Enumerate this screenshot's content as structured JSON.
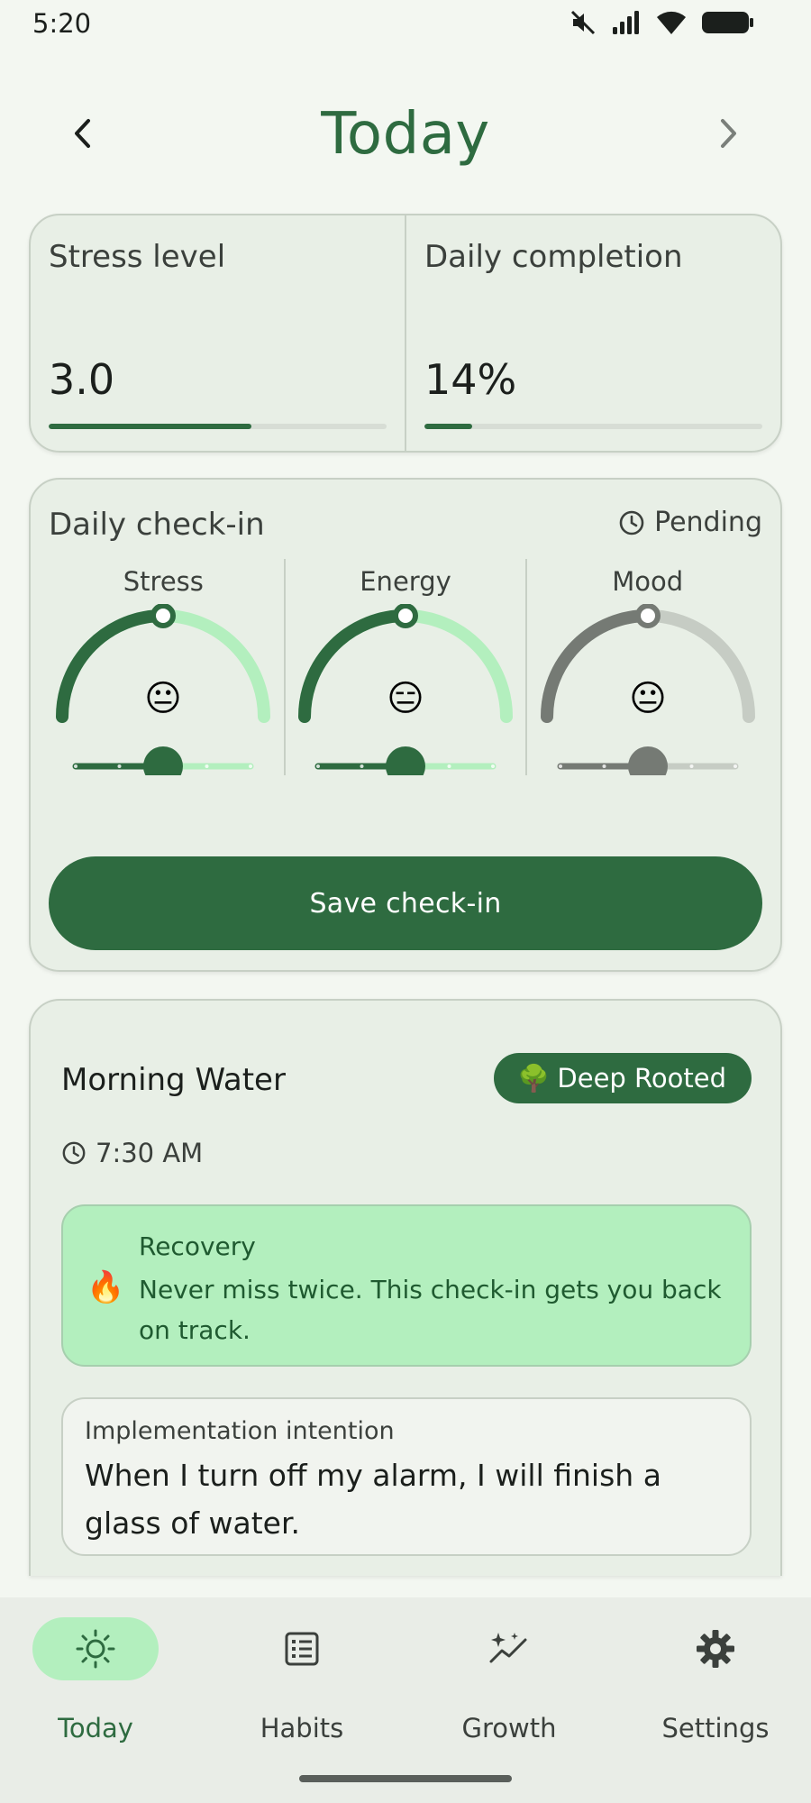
{
  "status_bar": {
    "time": "5:20",
    "icons": [
      "mute-icon",
      "signal-icon",
      "wifi-icon",
      "battery-icon"
    ]
  },
  "header": {
    "title": "Today",
    "prev_icon": "chevron-left-icon",
    "next_icon": "chevron-right-icon"
  },
  "stats": {
    "stress": {
      "label": "Stress level",
      "value": "3.0",
      "progress": 0.6
    },
    "completion": {
      "label": "Daily completion",
      "value": "14%",
      "progress": 0.14
    }
  },
  "checkin": {
    "title": "Daily check-in",
    "status": "Pending",
    "status_icon": "clock-icon",
    "dials": [
      {
        "label": "Stress",
        "emoji": "😐",
        "level": 0.5,
        "color": "#2e6b40",
        "track": "#b3efbe"
      },
      {
        "label": "Energy",
        "emoji": "😑",
        "level": 0.5,
        "color": "#2e6b40",
        "track": "#b3efbe"
      },
      {
        "label": "Mood",
        "emoji": "😐",
        "level": 0.5,
        "color": "#757a74",
        "track": "#c6ccc4"
      }
    ],
    "save_label": "Save check-in"
  },
  "habit": {
    "name": "Morning Water",
    "badge": {
      "emoji": "🌳",
      "label": "Deep Rooted"
    },
    "time": "7:30 AM",
    "recovery": {
      "icon": "🔥",
      "title": "Recovery",
      "text": "Never miss twice. This check-in gets you back on track."
    },
    "intention": {
      "label": "Implementation intention",
      "text": "When I turn off my alarm, I will finish a glass of water."
    }
  },
  "bottom_nav": {
    "items": [
      {
        "label": "Today",
        "icon": "sun-icon",
        "active": true
      },
      {
        "label": "Habits",
        "icon": "list-icon",
        "active": false
      },
      {
        "label": "Growth",
        "icon": "sparkle-chart-icon",
        "active": false
      },
      {
        "label": "Settings",
        "icon": "gear-icon",
        "active": false
      }
    ]
  },
  "colors": {
    "primary": "#2e6b40",
    "primary_container": "#b3efbe",
    "background": "#f3f7f1",
    "card": "#e8efe6"
  }
}
